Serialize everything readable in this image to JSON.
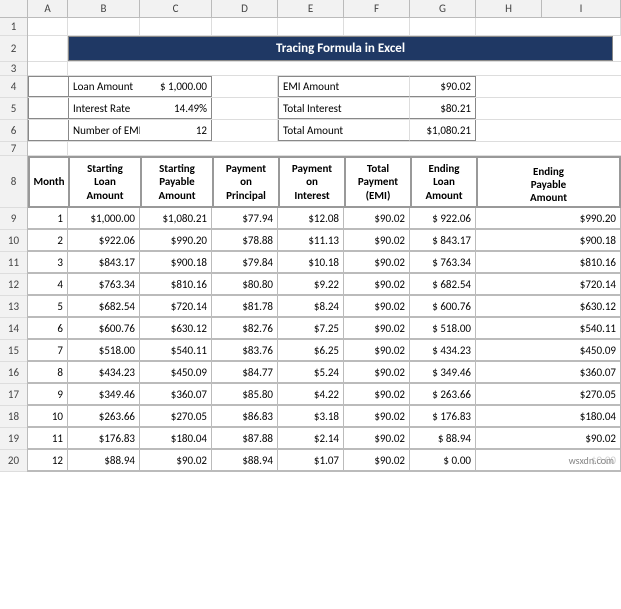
{
  "title": "Tracing Formula in Excel",
  "col_headers": [
    "",
    "A",
    "B",
    "C",
    "D",
    "E",
    "F",
    "G",
    "H",
    "I"
  ],
  "row_numbers": [
    "1",
    "2",
    "3",
    "4",
    "5",
    "6",
    "7",
    "8",
    "9",
    "10",
    "11",
    "12",
    "13",
    "14",
    "15",
    "16",
    "17",
    "18",
    "19",
    "20"
  ],
  "info_left": [
    {
      "label": "Loan Amount",
      "value": "$ 1,000.00"
    },
    {
      "label": "Interest Rate",
      "value": "14.49%"
    },
    {
      "label": "Number of EMIs",
      "value": "12"
    }
  ],
  "info_right": [
    {
      "label": "EMI Amount",
      "value": "$90.02"
    },
    {
      "label": "Total Interest",
      "value": "$80.21"
    },
    {
      "label": "Total Amount Payable",
      "value": "$1,080.21"
    }
  ],
  "table_headers": [
    "Month",
    "Starting Loan Amount",
    "Starting Payable Amount",
    "Payment on Principal",
    "Payment on Interest",
    "Total Payment (EMI)",
    "Ending Loan Amount",
    "Ending Payable Amount"
  ],
  "table_data": [
    [
      "1",
      "$1,000.00",
      "$1,080.21",
      "$77.94",
      "$12.08",
      "$90.02",
      "$ 922.06",
      "$990.20"
    ],
    [
      "2",
      "$922.06",
      "$990.20",
      "$78.88",
      "$11.13",
      "$90.02",
      "$ 843.17",
      "$900.18"
    ],
    [
      "3",
      "$843.17",
      "$900.18",
      "$79.84",
      "$10.18",
      "$90.02",
      "$ 763.34",
      "$810.16"
    ],
    [
      "4",
      "$763.34",
      "$810.16",
      "$80.80",
      "$9.22",
      "$90.02",
      "$ 682.54",
      "$720.14"
    ],
    [
      "5",
      "$682.54",
      "$720.14",
      "$81.78",
      "$8.24",
      "$90.02",
      "$ 600.76",
      "$630.12"
    ],
    [
      "6",
      "$600.76",
      "$630.12",
      "$82.76",
      "$7.25",
      "$90.02",
      "$ 518.00",
      "$540.11"
    ],
    [
      "7",
      "$518.00",
      "$540.11",
      "$83.76",
      "$6.25",
      "$90.02",
      "$ 434.23",
      "$450.09"
    ],
    [
      "8",
      "$434.23",
      "$450.09",
      "$84.77",
      "$5.24",
      "$90.02",
      "$ 349.46",
      "$360.07"
    ],
    [
      "9",
      "$349.46",
      "$360.07",
      "$85.80",
      "$4.22",
      "$90.02",
      "$ 263.66",
      "$270.05"
    ],
    [
      "10",
      "$263.66",
      "$270.05",
      "$86.83",
      "$3.18",
      "$90.02",
      "$ 176.83",
      "$180.04"
    ],
    [
      "11",
      "$176.83",
      "$180.04",
      "$87.88",
      "$2.14",
      "$90.02",
      "$  88.94",
      "$90.02"
    ],
    [
      "12",
      "$88.94",
      "$90.02",
      "$88.94",
      "$1.07",
      "$90.02",
      "$   0.00",
      "$0.00"
    ]
  ],
  "watermark": "wsxdn.com"
}
